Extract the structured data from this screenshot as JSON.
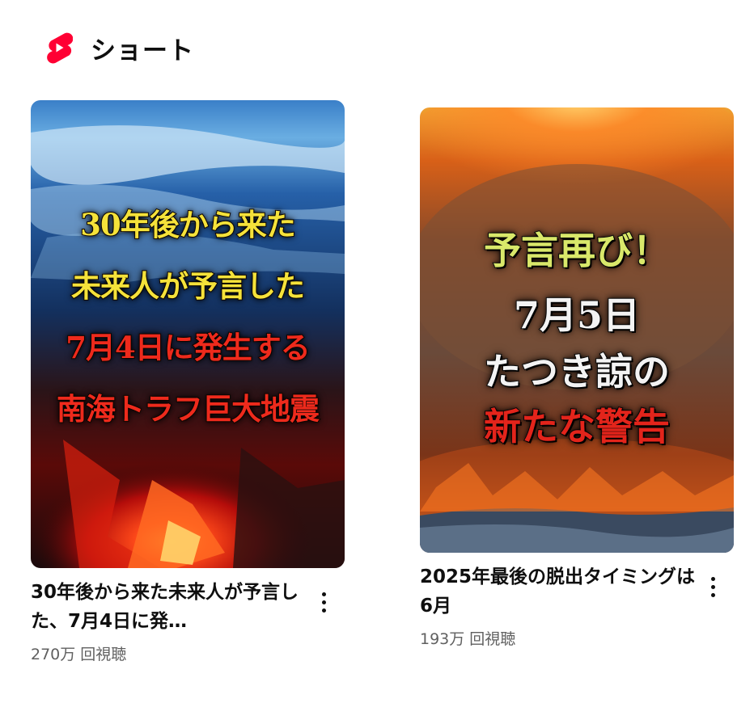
{
  "header": {
    "title": "ショート",
    "icon": "youtube-shorts-icon",
    "brand_color": "#ff0033"
  },
  "shorts": [
    {
      "thumbnail": {
        "overlay_lines": [
          "30年後から来た",
          "未来人が予言した",
          "7月4日に発生する",
          "南海トラフ巨大地震"
        ]
      },
      "title": "30年後から来た未来人が予言した、7月4日に発…",
      "views": "270万 回視聴",
      "menu_icon": "more-vert-icon"
    },
    {
      "thumbnail": {
        "overlay_lines": [
          "予言再び！",
          "7月5日",
          "たつき諒の",
          "新たな警告"
        ]
      },
      "title": "2025年最後の脱出タイミングは6月",
      "views": "193万 回視聴",
      "menu_icon": "more-vert-icon"
    }
  ]
}
